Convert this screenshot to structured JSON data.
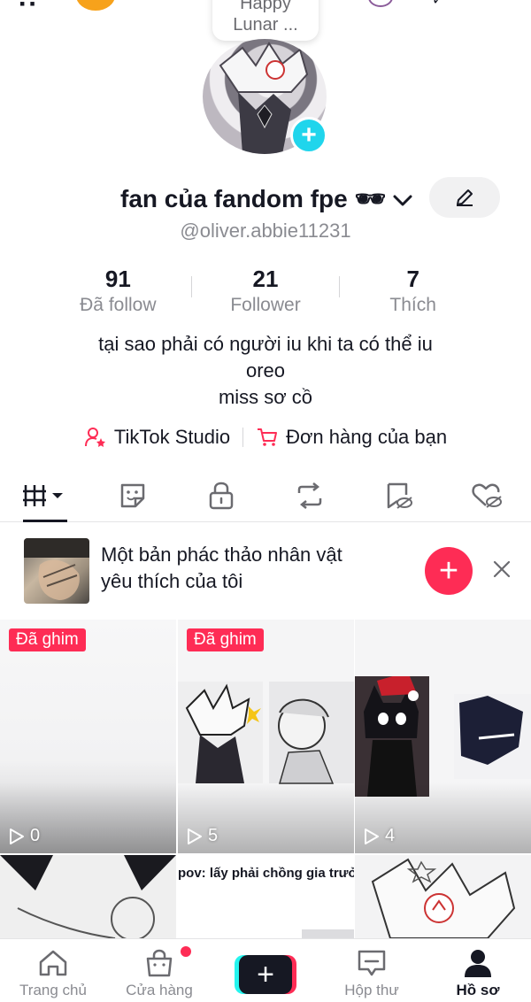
{
  "note": {
    "line1": "Happy",
    "line2": "Lunar ..."
  },
  "profile": {
    "name": "fan của fandom fpe 🕶",
    "username": "@oliver.abbie11231"
  },
  "stats": [
    {
      "value": "91",
      "label": "Đã follow"
    },
    {
      "value": "21",
      "label": "Follower"
    },
    {
      "value": "7",
      "label": "Thích"
    }
  ],
  "bio": {
    "line1": "tại sao phải có người iu khi ta có thể iu",
    "line2": "oreo",
    "line3": "miss sơ cồ"
  },
  "links": {
    "studio": "TikTok Studio",
    "orders": "Đơn hàng của bạn"
  },
  "tabs": [
    "videos-grid-icon",
    "favorites-sticker-icon",
    "private-lock-icon",
    "repost-icon",
    "saved-hidden-icon",
    "liked-hidden-icon"
  ],
  "draft": {
    "line1": "Một bản phác thảo nhân vật",
    "line2": "yêu thích của tôi"
  },
  "videos": [
    {
      "pinned": "Đã ghim",
      "views": "0"
    },
    {
      "pinned": "Đã ghim",
      "views": "5"
    },
    {
      "pinned": "",
      "views": "4"
    },
    {
      "caption": ""
    },
    {
      "caption": "pov: lấy phải chồng gia trưởng."
    },
    {
      "caption": ""
    }
  ],
  "nav": {
    "home": "Trang chủ",
    "shop": "Cửa hàng",
    "inbox": "Hộp thư",
    "profile": "Hồ sơ"
  },
  "colors": {
    "accent": "#fe2c55",
    "cyan": "#25f4ee",
    "text": "#161823",
    "muted": "#8a8b91"
  }
}
